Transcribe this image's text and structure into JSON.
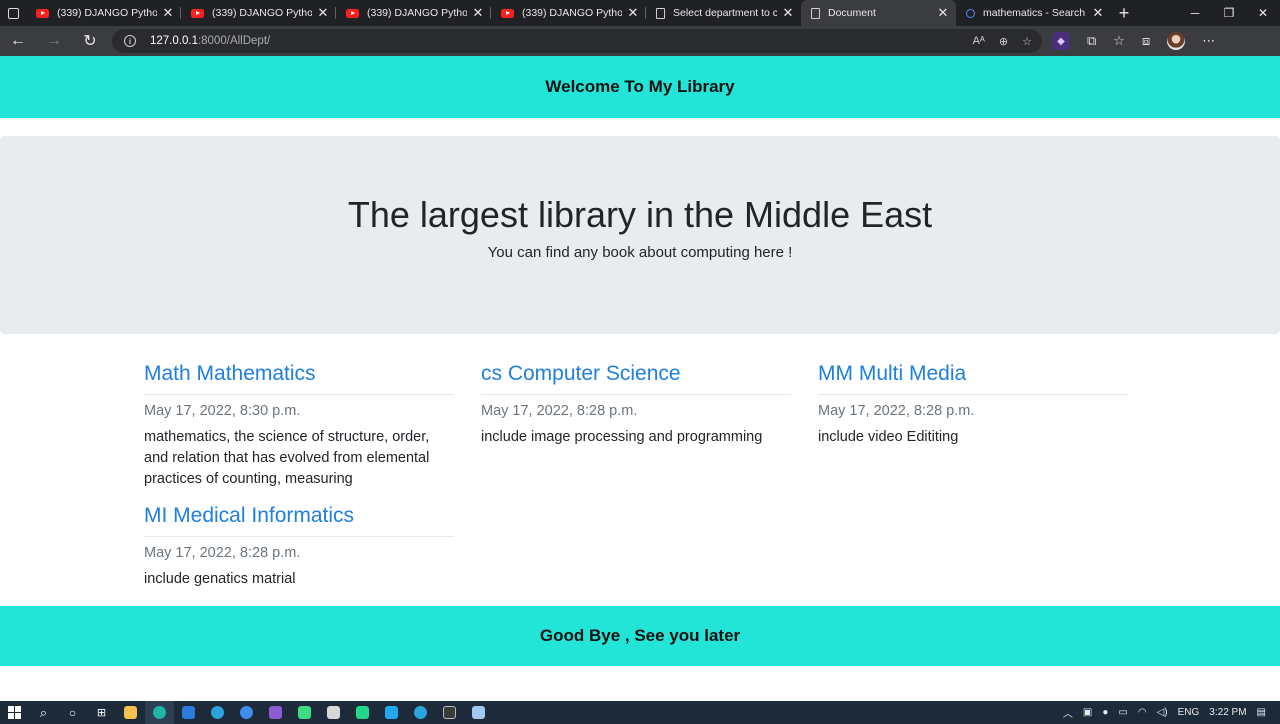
{
  "browser": {
    "tabs": [
      {
        "title": "(339) DJANGO Python L",
        "icon": "youtube-icon"
      },
      {
        "title": "(339) DJANGO Python L",
        "icon": "youtube-icon"
      },
      {
        "title": "(339) DJANGO Python L",
        "icon": "youtube-icon"
      },
      {
        "title": "(339) DJANGO Python L",
        "icon": "youtube-icon"
      },
      {
        "title": "Select department to cl",
        "icon": "document-icon"
      },
      {
        "title": "Document",
        "icon": "document-icon",
        "active": true
      },
      {
        "title": "mathematics - Search",
        "icon": "search-icon"
      }
    ],
    "url_host": "127.0.0.1",
    "url_path": ":8000/AllDept/"
  },
  "page": {
    "header_title": "Welcome To My Library",
    "hero_title": "The largest library in the Middle East",
    "hero_subtitle": "You can find any book about computing here !",
    "departments": [
      {
        "title": "Math Mathematics",
        "date": "May 17, 2022, 8:30 p.m.",
        "description": "mathematics, the science of structure, order, and relation that has evolved from elemental practices of counting, measuring"
      },
      {
        "title": "cs Computer Science",
        "date": "May 17, 2022, 8:28 p.m.",
        "description": "include image processing and programming"
      },
      {
        "title": "MM Multi Media",
        "date": "May 17, 2022, 8:28 p.m.",
        "description": "include video Edititing"
      },
      {
        "title": "MI Medical Informatics",
        "date": "May 17, 2022, 8:28 p.m.",
        "description": "include genatics matrial"
      }
    ],
    "footer_title": "Good Bye , See you later"
  },
  "taskbar": {
    "language": "ENG",
    "time": "3:22 PM"
  },
  "colors": {
    "accent_bar": "#22e5d8",
    "link_blue": "#1e7fe0",
    "hero_bg": "#e9ecef"
  }
}
